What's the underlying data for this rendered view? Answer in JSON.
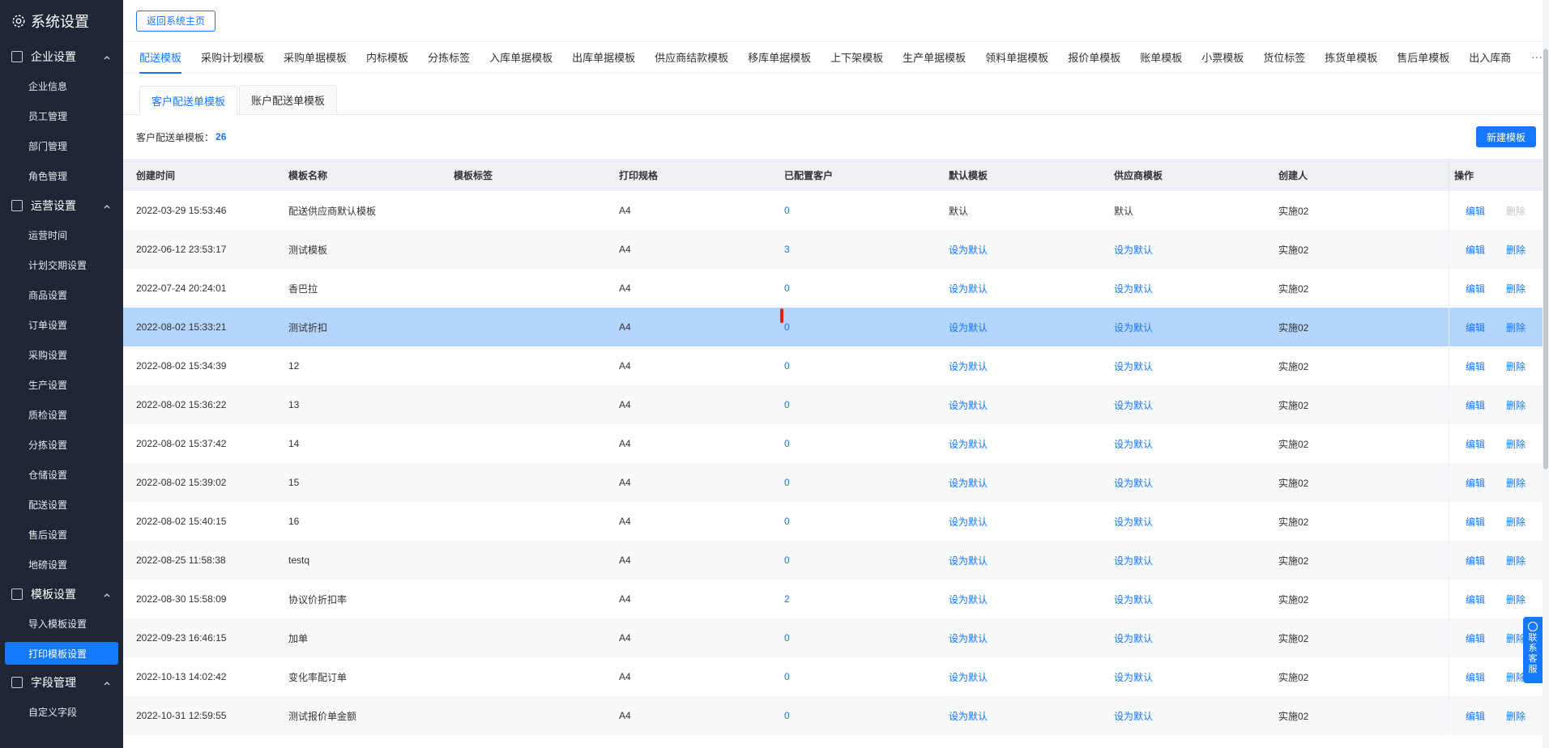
{
  "sidebar": {
    "title": "系统设置",
    "groups": [
      {
        "label": "企业设置",
        "items": [
          "企业信息",
          "员工管理",
          "部门管理",
          "角色管理"
        ]
      },
      {
        "label": "运营设置",
        "items": [
          "运营时间",
          "计划交期设置",
          "商品设置",
          "订单设置",
          "采购设置",
          "生产设置",
          "质检设置",
          "分拣设置",
          "仓储设置",
          "配送设置",
          "售后设置",
          "地磅设置"
        ]
      },
      {
        "label": "模板设置",
        "items": [
          "导入模板设置",
          "打印模板设置"
        ]
      },
      {
        "label": "字段管理",
        "items": [
          "自定义字段"
        ]
      }
    ],
    "active_item": "打印模板设置"
  },
  "topbar": {
    "back_label": "返回系统主页"
  },
  "tabs": [
    "配送模板",
    "采购计划模板",
    "采购单据模板",
    "内标模板",
    "分拣标签",
    "入库单据模板",
    "出库单据模板",
    "供应商结款模板",
    "移库单据模板",
    "上下架模板",
    "生产单据模板",
    "领料单据模板",
    "报价单模板",
    "账单模板",
    "小票模板",
    "货位标签",
    "拣货单模板",
    "售后单模板",
    "出入库商"
  ],
  "tabs_more": "···",
  "subtabs": [
    "客户配送单模板",
    "账户配送单模板"
  ],
  "info": {
    "label": "客户配送单模板：",
    "count": "26",
    "new_label": "新建模板"
  },
  "table": {
    "headers": [
      "创建时间",
      "模板名称",
      "模板标签",
      "打印规格",
      "已配置客户",
      "默认模板",
      "供应商模板",
      "创建人",
      "操作"
    ],
    "rows": [
      {
        "time": "2022-03-29 15:53:46",
        "name": "配送供应商默认模板",
        "tag": "",
        "spec": "A4",
        "clients": "0",
        "default": "默认",
        "supplier": "默认",
        "creator": "实施02",
        "edit": "编辑",
        "del": "删除"
      },
      {
        "time": "2022-06-12 23:53:17",
        "name": "测试模板",
        "tag": "",
        "spec": "A4",
        "clients": "3",
        "default": "设为默认",
        "supplier": "设为默认",
        "creator": "实施02",
        "edit": "编辑",
        "del": "删除"
      },
      {
        "time": "2022-07-24 20:24:01",
        "name": "香巴拉",
        "tag": "",
        "spec": "A4",
        "clients": "0",
        "default": "设为默认",
        "supplier": "设为默认",
        "creator": "实施02",
        "edit": "编辑",
        "del": "删除"
      },
      {
        "time": "2022-08-02 15:33:21",
        "name": "测试折扣",
        "tag": "",
        "spec": "A4",
        "clients": "0",
        "default": "设为默认",
        "supplier": "设为默认",
        "creator": "实施02",
        "edit": "编辑",
        "del": "删除"
      },
      {
        "time": "2022-08-02 15:34:39",
        "name": "12",
        "tag": "",
        "spec": "A4",
        "clients": "0",
        "default": "设为默认",
        "supplier": "设为默认",
        "creator": "实施02",
        "edit": "编辑",
        "del": "删除"
      },
      {
        "time": "2022-08-02 15:36:22",
        "name": "13",
        "tag": "",
        "spec": "A4",
        "clients": "0",
        "default": "设为默认",
        "supplier": "设为默认",
        "creator": "实施02",
        "edit": "编辑",
        "del": "删除"
      },
      {
        "time": "2022-08-02 15:37:42",
        "name": "14",
        "tag": "",
        "spec": "A4",
        "clients": "0",
        "default": "设为默认",
        "supplier": "设为默认",
        "creator": "实施02",
        "edit": "编辑",
        "del": "删除"
      },
      {
        "time": "2022-08-02 15:39:02",
        "name": "15",
        "tag": "",
        "spec": "A4",
        "clients": "0",
        "default": "设为默认",
        "supplier": "设为默认",
        "creator": "实施02",
        "edit": "编辑",
        "del": "删除"
      },
      {
        "time": "2022-08-02 15:40:15",
        "name": "16",
        "tag": "",
        "spec": "A4",
        "clients": "0",
        "default": "设为默认",
        "supplier": "设为默认",
        "creator": "实施02",
        "edit": "编辑",
        "del": "删除"
      },
      {
        "time": "2022-08-25 11:58:38",
        "name": "testq",
        "tag": "",
        "spec": "A4",
        "clients": "0",
        "default": "设为默认",
        "supplier": "设为默认",
        "creator": "实施02",
        "edit": "编辑",
        "del": "删除"
      },
      {
        "time": "2022-08-30 15:58:09",
        "name": "协议价折扣率",
        "tag": "",
        "spec": "A4",
        "clients": "2",
        "default": "设为默认",
        "supplier": "设为默认",
        "creator": "实施02",
        "edit": "编辑",
        "del": "删除"
      },
      {
        "time": "2022-09-23 16:46:15",
        "name": "加单",
        "tag": "",
        "spec": "A4",
        "clients": "0",
        "default": "设为默认",
        "supplier": "设为默认",
        "creator": "实施02",
        "edit": "编辑",
        "del": "删除"
      },
      {
        "time": "2022-10-13 14:02:42",
        "name": "变化率配订单",
        "tag": "",
        "spec": "A4",
        "clients": "0",
        "default": "设为默认",
        "supplier": "设为默认",
        "creator": "实施02",
        "edit": "编辑",
        "del": "删除"
      },
      {
        "time": "2022-10-31 12:59:55",
        "name": "测试报价单金额",
        "tag": "",
        "spec": "A4",
        "clients": "0",
        "default": "设为默认",
        "supplier": "设为默认",
        "creator": "实施02",
        "edit": "编辑",
        "del": "删除"
      }
    ],
    "selected_row": 3
  },
  "service": {
    "label": "联系客服"
  },
  "colors": {
    "accent": "#1677ff",
    "sidebar_bg": "#1f2736",
    "selected_row": "#b3d4fb",
    "highlight_box": "#e0201d"
  }
}
